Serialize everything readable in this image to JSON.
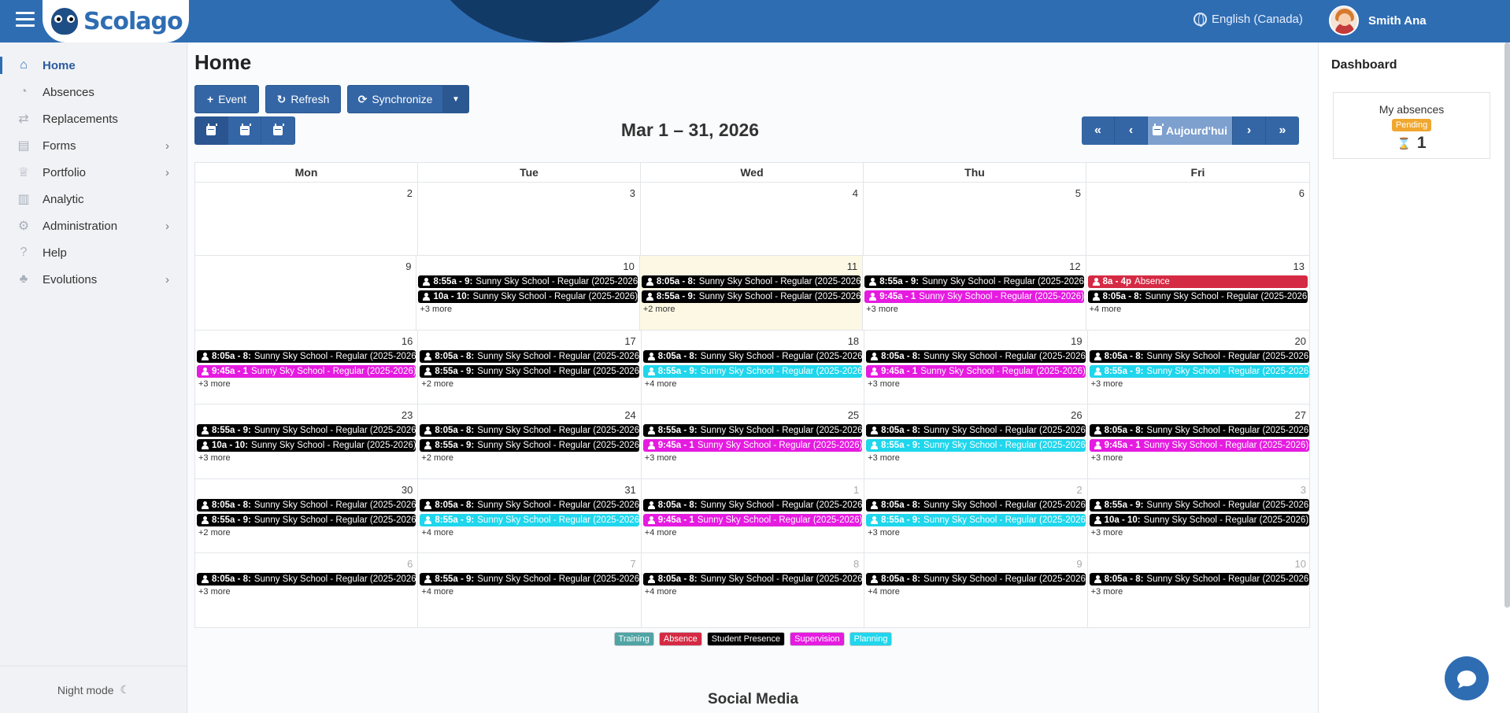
{
  "app": {
    "name": "Scolago",
    "language": "English (Canada)",
    "user": "Smith Ana"
  },
  "sidebar": {
    "items": [
      {
        "label": "Home",
        "icon": "home-icon",
        "active": true,
        "expandable": false
      },
      {
        "label": "Absences",
        "icon": "user-clock-icon",
        "active": false,
        "expandable": false
      },
      {
        "label": "Replacements",
        "icon": "replace-icon",
        "active": false,
        "expandable": false
      },
      {
        "label": "Forms",
        "icon": "form-icon",
        "active": false,
        "expandable": true
      },
      {
        "label": "Portfolio",
        "icon": "trophy-icon",
        "active": false,
        "expandable": true
      },
      {
        "label": "Analytic",
        "icon": "chart-icon",
        "active": false,
        "expandable": false
      },
      {
        "label": "Administration",
        "icon": "gear-icon",
        "active": false,
        "expandable": true
      },
      {
        "label": "Help",
        "icon": "help-icon",
        "active": false,
        "expandable": false
      },
      {
        "label": "Evolutions",
        "icon": "sprout-icon",
        "active": false,
        "expandable": true
      }
    ],
    "night_mode": "Night mode"
  },
  "page": {
    "title": "Home"
  },
  "toolbar": {
    "event": "Event",
    "refresh": "Refresh",
    "synchronize": "Synchronize"
  },
  "calendar": {
    "range": "Mar 1 – 31, 2026",
    "today_label": "Aujourd'hui",
    "weekdays": [
      "Mon",
      "Tue",
      "Wed",
      "Thu",
      "Fri"
    ],
    "weeks": [
      [
        {
          "num": "2",
          "events": [],
          "more": ""
        },
        {
          "num": "3",
          "events": [],
          "more": ""
        },
        {
          "num": "4",
          "events": [],
          "more": ""
        },
        {
          "num": "5",
          "events": [],
          "more": ""
        },
        {
          "num": "6",
          "events": [],
          "more": ""
        }
      ],
      [
        {
          "num": "9",
          "events": [],
          "more": ""
        },
        {
          "num": "10",
          "events": [
            {
              "time": "8:55a - 9:",
              "title": "Sunny Sky School - Regular (2025-2026)",
              "type": "presence"
            },
            {
              "time": "10a - 10:",
              "title": "Sunny Sky School - Regular (2025-2026)",
              "type": "presence"
            }
          ],
          "more": "+3 more"
        },
        {
          "num": "11",
          "today": true,
          "events": [
            {
              "time": "8:05a - 8:",
              "title": "Sunny Sky School - Regular (2025-2026)",
              "type": "presence"
            },
            {
              "time": "8:55a - 9:",
              "title": "Sunny Sky School - Regular (2025-2026)",
              "type": "presence"
            }
          ],
          "more": "+2 more"
        },
        {
          "num": "12",
          "events": [
            {
              "time": "8:55a - 9:",
              "title": "Sunny Sky School - Regular (2025-2026)",
              "type": "presence"
            },
            {
              "time": "9:45a - 1",
              "title": "Sunny Sky School - Regular (2025-2026)",
              "type": "supervision"
            }
          ],
          "more": "+3 more"
        },
        {
          "num": "13",
          "events": [
            {
              "time": "8a - 4p",
              "title": "Absence",
              "type": "absence"
            },
            {
              "time": "8:05a - 8:",
              "title": "Sunny Sky School - Regular (2025-2026)",
              "type": "presence"
            }
          ],
          "more": "+4 more"
        }
      ],
      [
        {
          "num": "16",
          "events": [
            {
              "time": "8:05a - 8:",
              "title": "Sunny Sky School - Regular (2025-2026)",
              "type": "presence"
            },
            {
              "time": "9:45a - 1",
              "title": "Sunny Sky School - Regular (2025-2026)",
              "type": "supervision"
            }
          ],
          "more": "+3 more"
        },
        {
          "num": "17",
          "events": [
            {
              "time": "8:05a - 8:",
              "title": "Sunny Sky School - Regular (2025-2026)",
              "type": "presence"
            },
            {
              "time": "8:55a - 9:",
              "title": "Sunny Sky School - Regular (2025-2026)",
              "type": "presence"
            }
          ],
          "more": "+2 more"
        },
        {
          "num": "18",
          "events": [
            {
              "time": "8:05a - 8:",
              "title": "Sunny Sky School - Regular (2025-2026)",
              "type": "presence"
            },
            {
              "time": "8:55a - 9:",
              "title": "Sunny Sky School - Regular (2025-2026)",
              "type": "planning"
            }
          ],
          "more": "+4 more"
        },
        {
          "num": "19",
          "events": [
            {
              "time": "8:05a - 8:",
              "title": "Sunny Sky School - Regular (2025-2026)",
              "type": "presence"
            },
            {
              "time": "9:45a - 1",
              "title": "Sunny Sky School - Regular (2025-2026)",
              "type": "supervision"
            }
          ],
          "more": "+3 more"
        },
        {
          "num": "20",
          "events": [
            {
              "time": "8:05a - 8:",
              "title": "Sunny Sky School - Regular (2025-2026)",
              "type": "presence"
            },
            {
              "time": "8:55a - 9:",
              "title": "Sunny Sky School - Regular (2025-2026)",
              "type": "planning"
            }
          ],
          "more": "+3 more"
        }
      ],
      [
        {
          "num": "23",
          "events": [
            {
              "time": "8:55a - 9:",
              "title": "Sunny Sky School - Regular (2025-2026)",
              "type": "presence"
            },
            {
              "time": "10a - 10:",
              "title": "Sunny Sky School - Regular (2025-2026)",
              "type": "presence"
            }
          ],
          "more": "+3 more"
        },
        {
          "num": "24",
          "events": [
            {
              "time": "8:05a - 8:",
              "title": "Sunny Sky School - Regular (2025-2026)",
              "type": "presence"
            },
            {
              "time": "8:55a - 9:",
              "title": "Sunny Sky School - Regular (2025-2026)",
              "type": "presence"
            }
          ],
          "more": "+2 more"
        },
        {
          "num": "25",
          "events": [
            {
              "time": "8:55a - 9:",
              "title": "Sunny Sky School - Regular (2025-2026)",
              "type": "presence"
            },
            {
              "time": "9:45a - 1",
              "title": "Sunny Sky School - Regular (2025-2026)",
              "type": "supervision"
            }
          ],
          "more": "+3 more"
        },
        {
          "num": "26",
          "events": [
            {
              "time": "8:05a - 8:",
              "title": "Sunny Sky School - Regular (2025-2026)",
              "type": "presence"
            },
            {
              "time": "8:55a - 9:",
              "title": "Sunny Sky School - Regular (2025-2026)",
              "type": "planning"
            }
          ],
          "more": "+3 more"
        },
        {
          "num": "27",
          "events": [
            {
              "time": "8:05a - 8:",
              "title": "Sunny Sky School - Regular (2025-2026)",
              "type": "presence"
            },
            {
              "time": "9:45a - 1",
              "title": "Sunny Sky School - Regular (2025-2026)",
              "type": "supervision"
            }
          ],
          "more": "+3 more"
        }
      ],
      [
        {
          "num": "30",
          "events": [
            {
              "time": "8:05a - 8:",
              "title": "Sunny Sky School - Regular (2025-2026)",
              "type": "presence"
            },
            {
              "time": "8:55a - 9:",
              "title": "Sunny Sky School - Regular (2025-2026)",
              "type": "presence"
            }
          ],
          "more": "+2 more"
        },
        {
          "num": "31",
          "events": [
            {
              "time": "8:05a - 8:",
              "title": "Sunny Sky School - Regular (2025-2026)",
              "type": "presence"
            },
            {
              "time": "8:55a - 9:",
              "title": "Sunny Sky School - Regular (2025-2026)",
              "type": "planning"
            }
          ],
          "more": "+4 more"
        },
        {
          "num": "1",
          "other": true,
          "events": [
            {
              "time": "8:05a - 8:",
              "title": "Sunny Sky School - Regular (2025-2026)",
              "type": "presence"
            },
            {
              "time": "9:45a - 1",
              "title": "Sunny Sky School - Regular (2025-2026)",
              "type": "supervision"
            }
          ],
          "more": "+4 more"
        },
        {
          "num": "2",
          "other": true,
          "events": [
            {
              "time": "8:05a - 8:",
              "title": "Sunny Sky School - Regular (2025-2026)",
              "type": "presence"
            },
            {
              "time": "8:55a - 9:",
              "title": "Sunny Sky School - Regular (2025-2026)",
              "type": "planning"
            }
          ],
          "more": "+3 more"
        },
        {
          "num": "3",
          "other": true,
          "events": [
            {
              "time": "8:55a - 9:",
              "title": "Sunny Sky School - Regular (2025-2026)",
              "type": "presence"
            },
            {
              "time": "10a - 10:",
              "title": "Sunny Sky School - Regular (2025-2026)",
              "type": "presence"
            }
          ],
          "more": "+3 more"
        }
      ],
      [
        {
          "num": "6",
          "other": true,
          "events": [
            {
              "time": "8:05a - 8:",
              "title": "Sunny Sky School - Regular (2025-2026)",
              "type": "presence"
            }
          ],
          "more": "+3 more"
        },
        {
          "num": "7",
          "other": true,
          "events": [
            {
              "time": "8:55a - 9:",
              "title": "Sunny Sky School - Regular (2025-2026)",
              "type": "presence"
            }
          ],
          "more": "+4 more"
        },
        {
          "num": "8",
          "other": true,
          "events": [
            {
              "time": "8:05a - 8:",
              "title": "Sunny Sky School - Regular (2025-2026)",
              "type": "presence"
            }
          ],
          "more": "+4 more"
        },
        {
          "num": "9",
          "other": true,
          "events": [
            {
              "time": "8:05a - 8:",
              "title": "Sunny Sky School - Regular (2025-2026)",
              "type": "presence"
            }
          ],
          "more": "+4 more"
        },
        {
          "num": "10",
          "other": true,
          "events": [
            {
              "time": "8:05a - 8:",
              "title": "Sunny Sky School - Regular (2025-2026)",
              "type": "presence"
            }
          ],
          "more": "+3 more"
        }
      ]
    ]
  },
  "legend": [
    {
      "label": "Training",
      "color": "#4fa4a4"
    },
    {
      "label": "Absence",
      "color": "#d52a44"
    },
    {
      "label": "Student Presence",
      "color": "#000000"
    },
    {
      "label": "Supervision",
      "color": "#e51be0"
    },
    {
      "label": "Planning",
      "color": "#1fd6ec"
    }
  ],
  "social": {
    "title": "Social Media"
  },
  "dashboard": {
    "title": "Dashboard",
    "card": {
      "label": "My absences",
      "status": "Pending",
      "count": "1"
    }
  },
  "colors": {
    "primary": "#3466a6",
    "topbar": "#2f6db3",
    "today": "#fcf8e3"
  }
}
